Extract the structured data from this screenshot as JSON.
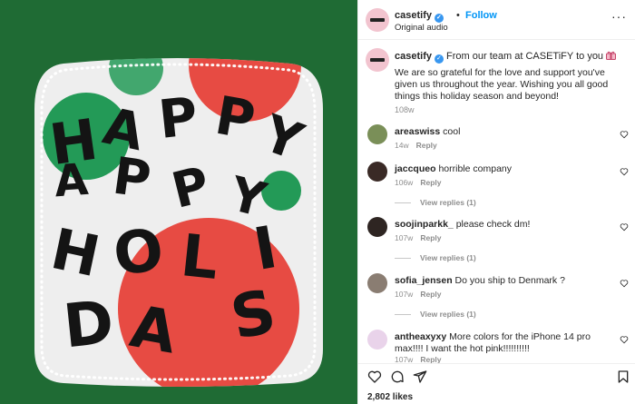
{
  "image": {
    "art_letters": [
      "H",
      "A",
      "P",
      "P",
      "Y",
      "H",
      "A",
      "P",
      "P",
      "Y",
      "H",
      "O",
      "L",
      "I",
      "D",
      "A",
      "S"
    ],
    "colors": {
      "background": "#1f6b34",
      "card": "#eeeeee",
      "red": "#e74b43",
      "green": "#239a57",
      "lights": "#ffffff",
      "letters": "#141414"
    }
  },
  "header": {
    "username": "casetify",
    "verified_icon": "verified-badge-icon",
    "separator": "•",
    "follow_label": "Follow",
    "audio": "Original audio",
    "more_icon": "more-options-icon",
    "more_glyph": "···"
  },
  "caption": {
    "username": "casetify",
    "headline": "From our team at CASETiFY to you",
    "emoji_icon": "gift-icon",
    "body": "We are so grateful for the love and support you've given us throughout the year. Wishing you all good things this holiday season and beyond!",
    "time": "108w"
  },
  "comments": [
    {
      "username": "areaswiss",
      "text": "cool",
      "time": "14w",
      "reply_label": "Reply",
      "view_replies": ""
    },
    {
      "username": "jaccqueo",
      "text": "horrible company",
      "time": "106w",
      "reply_label": "Reply",
      "view_replies": "View replies (1)"
    },
    {
      "username": "soojinparkk_",
      "text": "please check dm!",
      "time": "107w",
      "reply_label": "Reply",
      "view_replies": "View replies (1)"
    },
    {
      "username": "sofia_jensen",
      "text": "Do you ship to Denmark ?",
      "time": "107w",
      "reply_label": "Reply",
      "view_replies": "View replies (1)"
    },
    {
      "username": "antheaxyxy",
      "text": "More colors for the iPhone 14 pro max!!!! I want the hot pink!!!!!!!!!!",
      "time": "107w",
      "reply_label": "Reply",
      "view_replies": ""
    }
  ],
  "actions": {
    "icons": [
      "heart-icon",
      "comment-icon",
      "share-icon",
      "save-icon"
    ],
    "likes": "2,802 likes"
  }
}
